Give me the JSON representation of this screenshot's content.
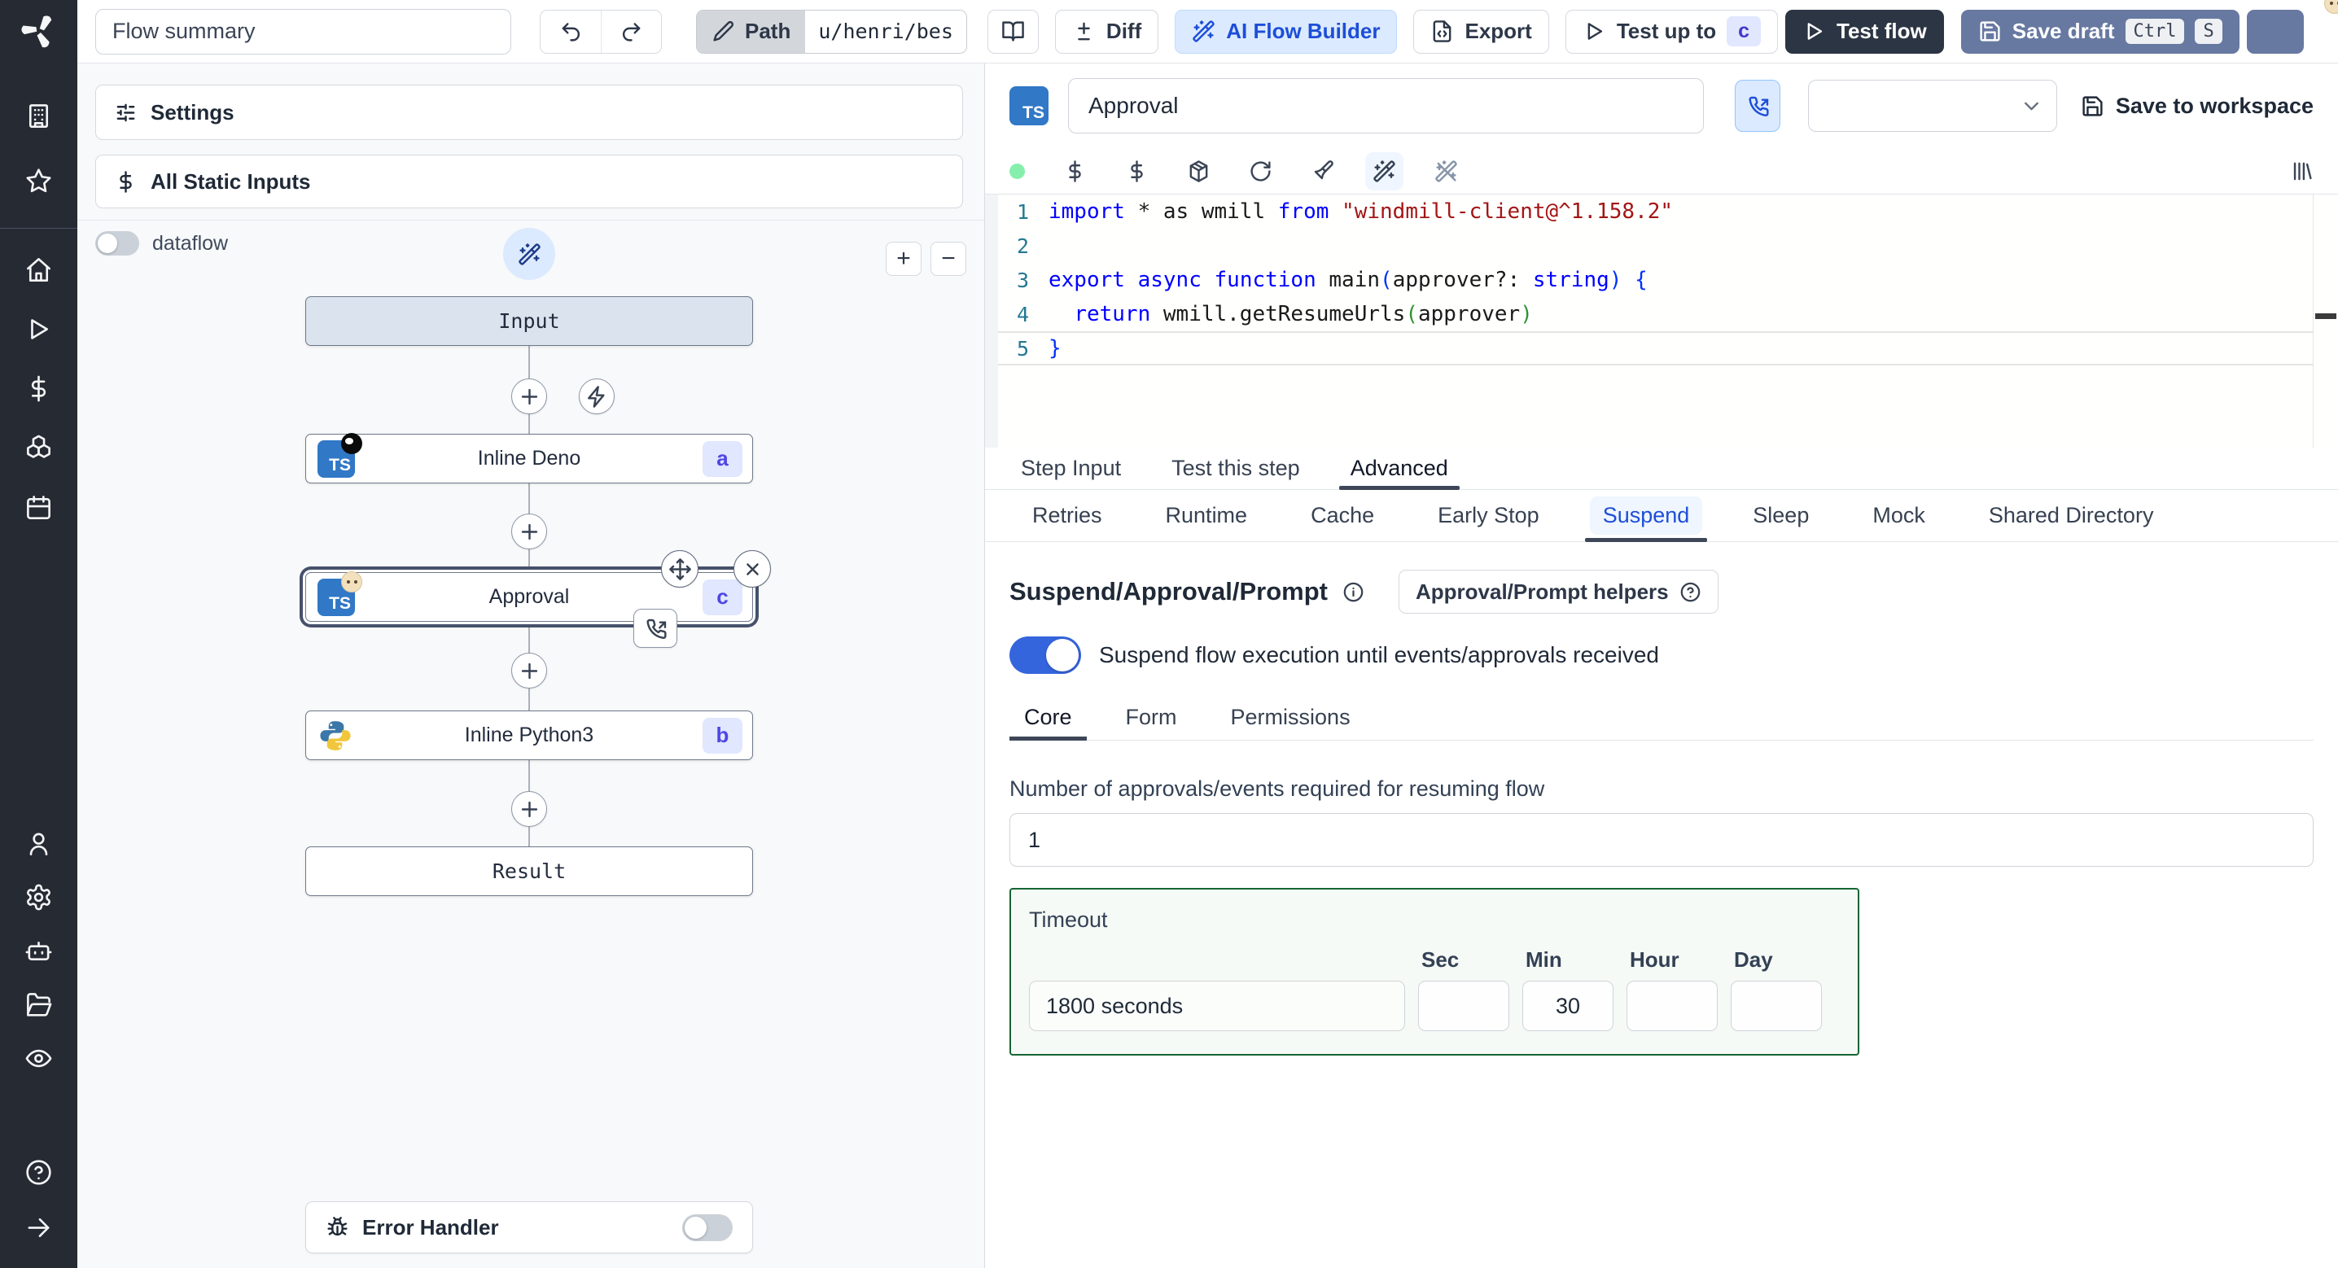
{
  "app": {
    "title": "Windmill flow editor"
  },
  "topbar": {
    "flow_summary_value": "Flow summary",
    "path_label": "Path",
    "path_value": "u/henri/bes",
    "diff_label": "Diff",
    "ai_builder_label": "AI Flow Builder",
    "export_label": "Export",
    "test_up_to_label": "Test up to",
    "test_up_to_badge": "c",
    "test_flow_label": "Test flow",
    "save_draft_label": "Save draft",
    "save_draft_keys": [
      "Ctrl",
      "S"
    ]
  },
  "sidebar": {
    "groups": {
      "workspace": [
        "building",
        "star"
      ],
      "nav": [
        "home",
        "play",
        "dollar",
        "cubes",
        "calendar"
      ],
      "admin": [
        "user",
        "gear",
        "bot",
        "folder",
        "eye"
      ],
      "footer": [
        "help",
        "arrow-right"
      ]
    }
  },
  "graph": {
    "settings_label": "Settings",
    "static_inputs_label": "All Static Inputs",
    "dataflow_label": "dataflow",
    "dataflow_on": false,
    "zoom_in_label": "+",
    "zoom_out_label": "−",
    "input_node_label": "Input",
    "result_node_label": "Result",
    "steps": [
      {
        "label": "Inline Deno",
        "badge": "a",
        "lang": "deno",
        "selected": false
      },
      {
        "label": "Approval",
        "badge": "c",
        "lang": "bun",
        "selected": true
      },
      {
        "label": "Inline Python3",
        "badge": "b",
        "lang": "python3",
        "selected": false
      }
    ],
    "error_handler_label": "Error Handler",
    "error_handler_on": false
  },
  "editor": {
    "step_name_value": "Approval",
    "language_select_value": "",
    "save_to_workspace_label": "Save to workspace",
    "code": {
      "lines": [
        {
          "n": "1",
          "current": false,
          "tokens": [
            {
              "c": "kw",
              "t": "import"
            },
            {
              "c": "tx",
              "t": " * as wmill "
            },
            {
              "c": "kw",
              "t": "from"
            },
            {
              "c": "tx",
              "t": " "
            },
            {
              "c": "st",
              "t": "\"windmill-client@^1.158.2\""
            }
          ]
        },
        {
          "n": "2",
          "current": false,
          "tokens": []
        },
        {
          "n": "3",
          "current": false,
          "tokens": [
            {
              "c": "kw",
              "t": "export"
            },
            {
              "c": "tx",
              "t": " "
            },
            {
              "c": "kw",
              "t": "async"
            },
            {
              "c": "tx",
              "t": " "
            },
            {
              "c": "kw",
              "t": "function"
            },
            {
              "c": "tx",
              "t": " main"
            },
            {
              "c": "pb",
              "t": "("
            },
            {
              "c": "tx",
              "t": "approver?: "
            },
            {
              "c": "kw",
              "t": "string"
            },
            {
              "c": "pb",
              "t": ")"
            },
            {
              "c": "tx",
              "t": " "
            },
            {
              "c": "pb",
              "t": "{"
            }
          ]
        },
        {
          "n": "4",
          "current": false,
          "tokens": [
            {
              "c": "tx",
              "t": "  "
            },
            {
              "c": "kw",
              "t": "return"
            },
            {
              "c": "tx",
              "t": " wmill.getResumeUrls"
            },
            {
              "c": "pg",
              "t": "("
            },
            {
              "c": "tx",
              "t": "approver"
            },
            {
              "c": "pg",
              "t": ")"
            }
          ]
        },
        {
          "n": "5",
          "current": true,
          "tokens": [
            {
              "c": "pb",
              "t": "}"
            }
          ]
        }
      ]
    },
    "tabs": [
      {
        "label": "Step Input",
        "active": false
      },
      {
        "label": "Test this step",
        "active": false
      },
      {
        "label": "Advanced",
        "active": true
      }
    ],
    "advanced_tabs": [
      {
        "label": "Retries",
        "active": false
      },
      {
        "label": "Runtime",
        "active": false
      },
      {
        "label": "Cache",
        "active": false
      },
      {
        "label": "Early Stop",
        "active": false
      },
      {
        "label": "Suspend",
        "active": true
      },
      {
        "label": "Sleep",
        "active": false
      },
      {
        "label": "Mock",
        "active": false
      },
      {
        "label": "Shared Directory",
        "active": false
      }
    ],
    "suspend": {
      "heading": "Suspend/Approval/Prompt",
      "helpers_button_label": "Approval/Prompt helpers",
      "toggle_label": "Suspend flow execution until events/approvals received",
      "toggle_on": true,
      "tabs": [
        {
          "label": "Core",
          "active": true
        },
        {
          "label": "Form",
          "active": false
        },
        {
          "label": "Permissions",
          "active": false
        }
      ],
      "approvals_label": "Number of approvals/events required for resuming flow",
      "approvals_value": "1",
      "timeout": {
        "label": "Timeout",
        "display_value": "1800 seconds",
        "units": [
          {
            "label": "Sec",
            "value": ""
          },
          {
            "label": "Min",
            "value": "30"
          },
          {
            "label": "Hour",
            "value": ""
          },
          {
            "label": "Day",
            "value": ""
          }
        ]
      }
    }
  },
  "colors": {
    "sidebar_bg": "#262a33",
    "toggle_on": "#3565dd",
    "save_draft_bg": "#6779a1",
    "test_flow_bg": "#2c3543",
    "ai_builder_bg": "#dbeafe",
    "step_badge_bg": "#e0e7ff",
    "step_badge_text": "#4f46e5",
    "timeout_border": "#166534",
    "suspend_active_text": "#1d4ed8",
    "code_keyword": "#0000ff",
    "code_string": "#a31515",
    "status_dot": "#86efac"
  },
  "icons": {
    "building": "workspace-building-icon",
    "star": "favorites-star-icon",
    "home": "home-icon",
    "play": "runs-play-icon",
    "dollar": "variables-dollar-icon",
    "cubes": "resources-cubes-icon",
    "calendar": "schedules-calendar-icon",
    "user": "users-icon",
    "gear": "settings-gear-icon",
    "bot": "workers-robot-icon",
    "folder": "folders-icon",
    "eye": "audit-eye-icon",
    "help": "help-question-icon",
    "arrow-right": "expand-arrow-icon",
    "undo": "undo-icon",
    "redo": "redo-icon",
    "pencil": "edit-pencil-icon",
    "book": "tutorial-book-icon",
    "diff": "diff-plus-minus-icon",
    "wand": "magic-wand-icon",
    "wand-off": "magic-wand-off-icon",
    "file-code": "export-file-icon",
    "play-o": "play-outline-icon",
    "floppy": "save-floppy-icon",
    "phone-in": "phone-incoming-icon",
    "chevron": "chevron-down-icon",
    "sliders": "sliders-icon",
    "plus": "plus-icon",
    "minus": "minus-icon",
    "bolt": "trigger-bolt-icon",
    "move": "move-icon",
    "x": "close-x-icon",
    "bug": "bug-icon",
    "info": "info-icon",
    "question": "question-circle-icon",
    "rotate": "reload-icon",
    "package": "package-icon",
    "brush": "format-brush-icon",
    "library": "library-icon"
  }
}
